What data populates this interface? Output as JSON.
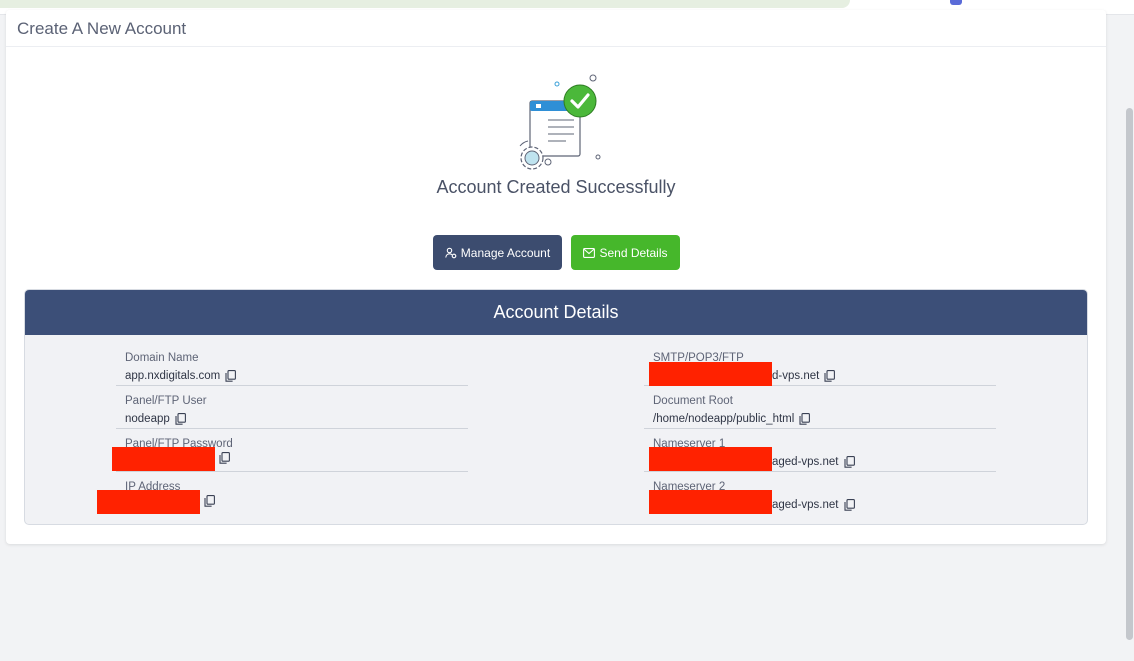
{
  "page": {
    "title": "Create A New Account",
    "success_message": "Account Created Successfully"
  },
  "actions": {
    "manage_label": "Manage Account",
    "send_label": "Send Details"
  },
  "details": {
    "heading": "Account Details",
    "left": [
      {
        "label": "Domain Name",
        "value": "app.nxdigitals.com"
      },
      {
        "label": "Panel/FTP User",
        "value": "nodeapp"
      },
      {
        "label": "Panel/FTP Password",
        "value": ""
      },
      {
        "label": "IP Address",
        "value": ""
      }
    ],
    "right": [
      {
        "label": "SMTP/POP3/FTP",
        "value": "d-vps.net"
      },
      {
        "label": "Document Root",
        "value": "/home/nodeapp/public_html"
      },
      {
        "label": "Nameserver 1",
        "value": "aged-vps.net"
      },
      {
        "label": "Nameserver 2",
        "value": "aged-vps.net"
      }
    ]
  },
  "icons": {
    "copy": "copy-icon",
    "manage": "users-gear-icon",
    "send": "envelope-icon",
    "success": "check-circle-icon"
  },
  "colors": {
    "primary": "#3c4c6f",
    "success": "#46b72b",
    "details_header": "#3c4f78",
    "redaction": "#ff2200"
  }
}
